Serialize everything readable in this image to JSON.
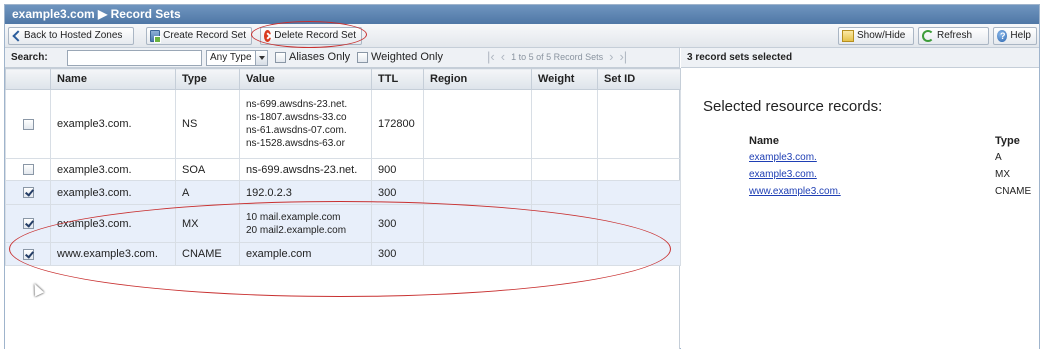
{
  "title": "example3.com ▶ Record Sets",
  "toolbar": {
    "back_label": "Back to Hosted Zones",
    "create_label": "Create Record Set",
    "delete_label": "Delete Record Set",
    "showhide_label": "Show/Hide",
    "refresh_label": "Refresh",
    "help_label": "Help",
    "icons": [
      "back-arrow-icon",
      "create-record-icon",
      "delete-icon",
      "showhide-icon",
      "refresh-icon",
      "help-icon"
    ]
  },
  "search": {
    "label": "Search:",
    "value": "",
    "type_filter": "Any Type",
    "aliases_label": "Aliases Only",
    "weighted_label": "Weighted Only",
    "pager_text": "1 to 5 of 5 Record Sets"
  },
  "table": {
    "columns": [
      "Name",
      "Type",
      "Value",
      "TTL",
      "Region",
      "Weight",
      "Set ID"
    ],
    "rows": [
      {
        "checked": false,
        "name": "example3.com.",
        "type": "NS",
        "value": [
          "ns-699.awsdns-23.net.",
          "ns-1807.awsdns-33.co",
          "ns-61.awsdns-07.com.",
          "ns-1528.awsdns-63.or"
        ],
        "ttl": "172800",
        "region": "",
        "weight": "",
        "set_id": ""
      },
      {
        "checked": false,
        "name": "example3.com.",
        "type": "SOA",
        "value": [
          "ns-699.awsdns-23.net."
        ],
        "ttl": "900",
        "region": "",
        "weight": "",
        "set_id": ""
      },
      {
        "checked": true,
        "name": "example3.com.",
        "type": "A",
        "value": [
          "192.0.2.3"
        ],
        "ttl": "300",
        "region": "",
        "weight": "",
        "set_id": ""
      },
      {
        "checked": true,
        "name": "example3.com.",
        "type": "MX",
        "value": [
          "10 mail.example.com",
          "20 mail2.example.com"
        ],
        "ttl": "300",
        "region": "",
        "weight": "",
        "set_id": ""
      },
      {
        "checked": true,
        "name": "www.example3.com.",
        "type": "CNAME",
        "value": [
          "example.com"
        ],
        "ttl": "300",
        "region": "",
        "weight": "",
        "set_id": ""
      }
    ]
  },
  "right": {
    "header": "3 record sets selected",
    "title": "Selected resource records:",
    "col_name": "Name",
    "col_type": "Type",
    "records": [
      {
        "name": "example3.com.",
        "type": "A"
      },
      {
        "name": "example3.com.",
        "type": "MX"
      },
      {
        "name": "www.example3.com.",
        "type": "CNAME"
      }
    ]
  },
  "colors": {
    "highlight_circle": "#c83030",
    "titlebar": "#5a80ad",
    "link": "#1f3fb4"
  }
}
